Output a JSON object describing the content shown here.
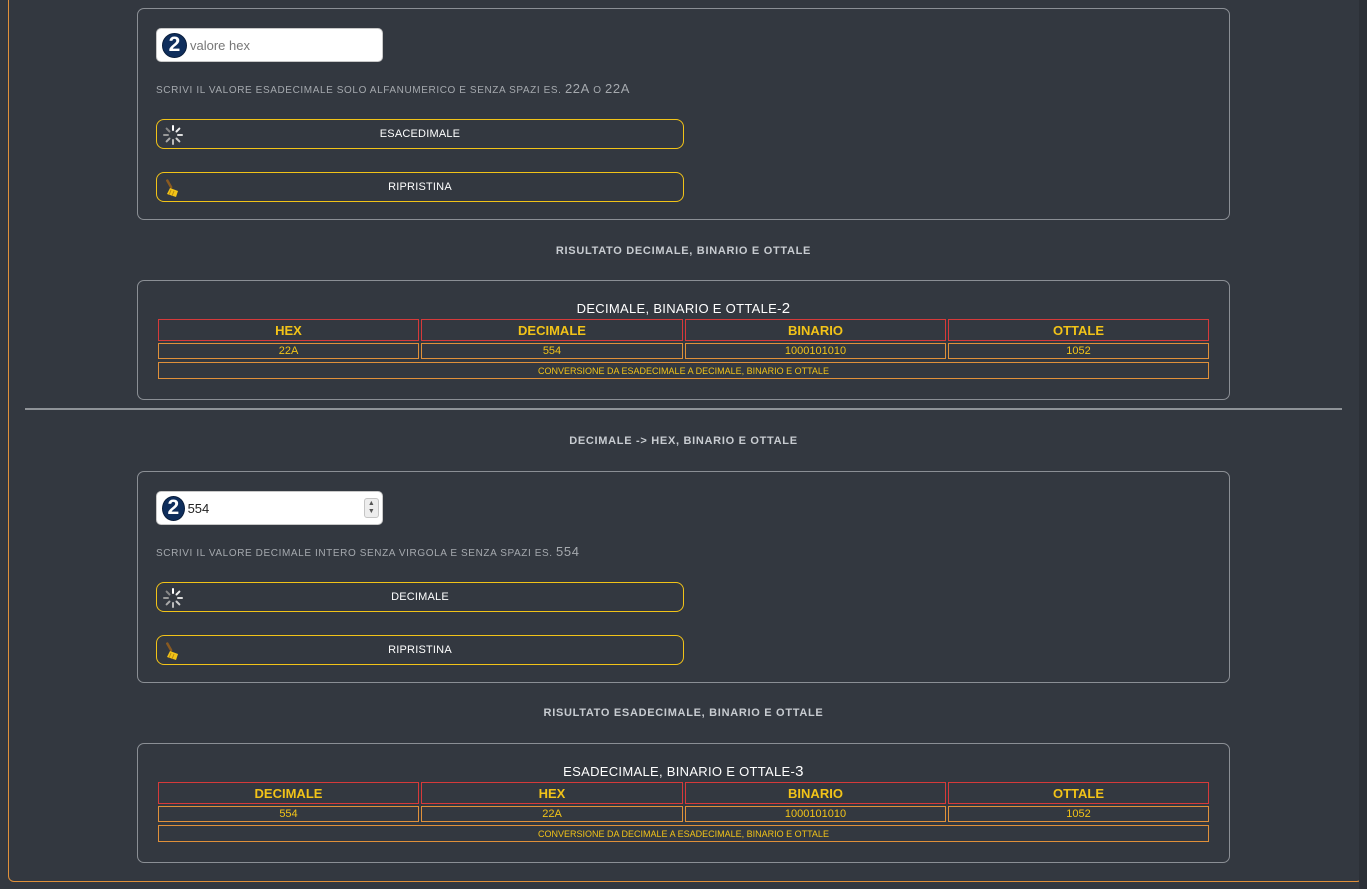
{
  "hex_section": {
    "input_placeholder": "valore hex",
    "input_value": "",
    "badge": "2",
    "hint_text": "Scrivi il valore esadecimale solo alfanumerico e senza spazi es.",
    "hint_example_1": "22A",
    "hint_or": "o",
    "hint_example_2": "22a",
    "convert_button": "ESACEDIMALE",
    "reset_button": "RIPRISTINA",
    "result_heading": "RISULTATO DECIMALE, BINARIO E OTTALE",
    "table": {
      "title": "DECIMALE, BINARIO E OTTALE-",
      "title_suffix": "2",
      "headers": [
        "HEX",
        "DECIMALE",
        "BINARIO",
        "OTTALE"
      ],
      "values": [
        "22A",
        "554",
        "1000101010",
        "1052"
      ],
      "footer": "CONVERSIONE DA ESADECIMALE A DECIMALE, BINARIO E OTTALE"
    }
  },
  "dec_section": {
    "heading": "DECIMALE -> HEX, BINARIO E OTTALE",
    "input_value": "554",
    "badge": "2",
    "hint_text": "Scrivi il valore decimale intero senza virgola e senza spazi es.",
    "hint_example": "554",
    "convert_button": "DECIMALE",
    "reset_button": "RIPRISTINA",
    "result_heading": "RISULTATO ESADECIMALE, BINARIO E OTTALE",
    "table": {
      "title": "ESADECIMALE, BINARIO E OTTALE-",
      "title_suffix": "3",
      "headers": [
        "DECIMALE",
        "HEX",
        "BINARIO",
        "OTTALE"
      ],
      "values": [
        "554",
        "22A",
        "1000101010",
        "1052"
      ],
      "footer": "CONVERSIONE DA DECIMALE A ESADECIMALE, BINARIO E OTTALE"
    }
  },
  "colors": {
    "background": "#333840",
    "accent_yellow": "#f2c318",
    "header_border_red": "#d63a3a",
    "cell_border_orange": "#e0903a",
    "badge_navy": "#0f2e5c"
  },
  "icons": {
    "convert": "loading-spinner-icon",
    "reset": "broom-icon"
  }
}
